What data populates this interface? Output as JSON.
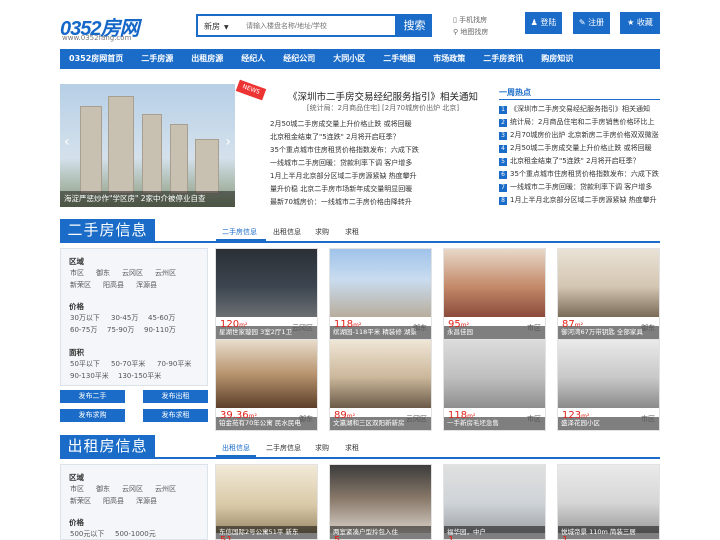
{
  "header": {
    "logo_text": "0352房网",
    "logo_url": "www.0352fang.com",
    "search_type": "新房",
    "search_placeholder": "请输入楼盘名称/地址/学校",
    "search_button": "搜索",
    "mobile_link": "手机找房",
    "map_link": "地图找房",
    "login": "登陆",
    "register": "注册",
    "favorite": "收藏"
  },
  "nav": [
    "0352房网首页",
    "二手房源",
    "出租房源",
    "经纪人",
    "经纪公司",
    "大同小区",
    "二手地图",
    "市场政策",
    "二手房资讯",
    "购房知识"
  ],
  "banner": {
    "caption": "海淀严惩炒作\"学区房\" 2家中介被停业自查"
  },
  "headline": {
    "title": "《深圳市二手房交易经纪服务指引》相关通知",
    "sub": "[统计局：2月商品住宅] [2月70城房价出炉 北京]",
    "items": [
      "2月50城二手房成交量上升价格止跌 或将回暖",
      "北京租金结束了\"5连跌\" 2月将开启旺季？",
      "35个重点城市住房租赁价格指数发布：六成下跌",
      "一线城市二手房回暖：贷款利率下调 客户增多",
      "1月上半月北京部分区域二手房源紧缺 热度攀升",
      "量升价稳 北京二手房市场新年成交量明显回暖",
      "最新70城房价：一线城市二手房价格由降转升"
    ]
  },
  "hot": {
    "title": "一周热点",
    "items": [
      "《深圳市二手房交易经纪服务指引》相关通知",
      "统计局：2月商品住宅和二手房销售价格环比上",
      "2月70城房价出炉 北京新房二手房价格双双微涨",
      "2月50城二手房成交量上升价格止跌 或将回暖",
      "北京租金结束了\"5连跌\" 2月将开启旺季？",
      "35个重点城市住房租赁价格指数发布：六成下跌",
      "一线城市二手房回暖：贷款利率下调 客户增多",
      "1月上半月北京部分区域二手房源紧缺 热度攀升"
    ]
  },
  "second_hand": {
    "title": "二手房信息",
    "tabs": [
      "二手房信息",
      "出租信息",
      "求购",
      "求租"
    ],
    "filter": {
      "area_title": "区域",
      "areas": [
        "市区",
        "御东",
        "云冈区",
        "云州区",
        "新荣区",
        "阳高县",
        "浑源县"
      ],
      "price_title": "价格",
      "prices": [
        "30万以下",
        "30-45万",
        "45-60万",
        "60-75万",
        "75-90万",
        "90-110万"
      ],
      "size_title": "面积",
      "sizes": [
        "50平以下",
        "50-70平米",
        "70-90平米",
        "90-130平米",
        "130-150平米"
      ],
      "buttons": [
        "发布二手",
        "发布出租",
        "发布求购",
        "发布求租"
      ]
    },
    "cards": [
      {
        "caption": "星湖世家璇园 3室2厅1卫",
        "price": "120",
        "unit": "m²",
        "district": "云冈区"
      },
      {
        "caption": "缤湖园-118平米 精装修 湖景",
        "price": "118",
        "unit": "m²",
        "district": "御东"
      },
      {
        "caption": "永昌佳园",
        "price": "95",
        "unit": "m²",
        "district": "市区"
      },
      {
        "caption": "御河湾67万带钥匙 全部家具",
        "price": "87",
        "unit": "m²",
        "district": "御东"
      },
      {
        "caption": "铂金苑有70年公寓 民水民电",
        "price": "39.36",
        "unit": "m²",
        "district": "御东"
      },
      {
        "caption": "文瀛湖和三区双阳新新房",
        "price": "89",
        "unit": "m²",
        "district": "云冈区"
      },
      {
        "caption": "一手新房毛坯急售",
        "price": "118",
        "unit": "m²",
        "district": "市区"
      },
      {
        "caption": "盛泽花园小区",
        "price": "123",
        "unit": "m²",
        "district": "市区"
      }
    ]
  },
  "rent": {
    "title": "出租房信息",
    "tabs": [
      "出租信息",
      "二手房信息",
      "求购",
      "求租"
    ],
    "filter": {
      "area_title": "区域",
      "areas": [
        "市区",
        "御东",
        "云冈区",
        "云州区",
        "新荣区",
        "阳高县",
        "浑源县"
      ],
      "price_title": "价格",
      "prices": [
        "500元以下",
        "500-1000元"
      ]
    },
    "cards": [
      {
        "caption": "东信国际2号公寓51平 新东"
      },
      {
        "caption": "两室紧凑户型拎包入住"
      },
      {
        "caption": "福华园，中户"
      },
      {
        "caption": "悦城帝景 110m 简装三居"
      }
    ],
    "price_fragments": [
      "51",
      "5",
      "1",
      "1"
    ]
  },
  "colors": {
    "brand": "#1a6cc8",
    "price": "#e2231a",
    "accent": "#f39800"
  }
}
